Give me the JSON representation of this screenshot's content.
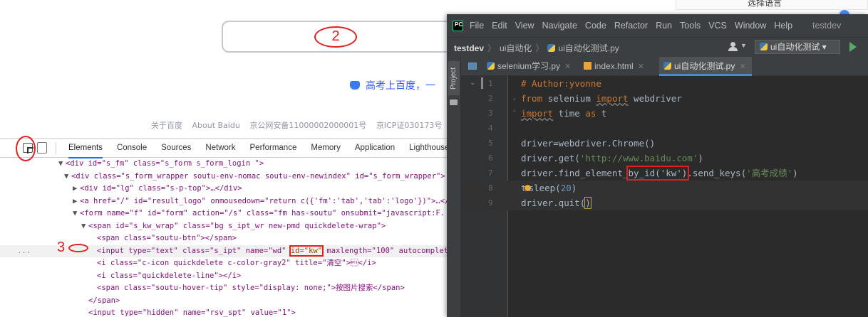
{
  "baidu": {
    "language_box": "选择语言",
    "annotation_2": "2",
    "hot_news": "高考上百度，一",
    "footer": [
      "关于百度",
      "About Baidu",
      "京公网安备11000002000001号",
      "京ICP证030173号",
      "©"
    ]
  },
  "devtools": {
    "annotation_1": "",
    "tabs": [
      "Elements",
      "Console",
      "Sources",
      "Network",
      "Performance",
      "Memory",
      "Application",
      "Lighthouse"
    ],
    "active_tab": "Elements",
    "annotation_3": "3",
    "gutter_dots": "...",
    "dom": {
      "l1": "<div id=\"s_fm\" class=\"s_form s_form_login \">",
      "l2": "<div class=\"s_form_wrapper soutu-env-nomac soutu-env-newindex\" id=\"s_form_wrapper\">",
      "l3": "<div id=\"lg\" class=\"s-p-top\">…</div>",
      "l4": "<a href=\"/\" id=\"result_logo\" onmousedown=\"return c({'fm':'tab','tab':'logo'})\">…</",
      "l5": "<form name=\"f\" id=\"form\" action=\"/s\" class=\"fm  has-soutu\" onsubmit=\"javascript:F.",
      "l6": "<span id=\"s_kw_wrap\" class=\"bg s_ipt_wr new-pmd quickdelete-wrap\">",
      "l7": "<span class=\"soutu-btn\"></span>",
      "l8a": "<input type=\"text\" class=\"s_ipt\" name=\"wd\" ",
      "l8b": "id=\"kw\"",
      "l8c": " maxlength=\"100\" autocomplet",
      "l9": "<i class=\"c-icon quickdelete c-color-gray2\" title=\"清空\">\u0011</i>",
      "l10": "<i class=\"quickdelete-line\"></i>",
      "l11": "<span class=\"soutu-hover-tip\" style=\"display: none;\">按图片搜索</span>",
      "l12": "</span>",
      "l13": "<input type=\"hidden\" name=\"rsv_spt\" value=\"1\">"
    }
  },
  "pycharm": {
    "menu": [
      "File",
      "Edit",
      "View",
      "Navigate",
      "Code",
      "Refactor",
      "Run",
      "Tools",
      "VCS",
      "Window",
      "Help"
    ],
    "menu_mnemonics": [
      "F",
      "E",
      "V",
      "N",
      "C",
      "R",
      "u",
      "T",
      "S",
      "W",
      "H"
    ],
    "project_title": "testdev",
    "breadcrumb": [
      "testdev",
      "ui自动化",
      "ui自动化测试.py"
    ],
    "run_config": "ui自动化测试 ▾",
    "side_label": "Project",
    "tabs": [
      "selenium学习.py",
      "index.html",
      "ui自动化测试.py"
    ],
    "active_tab": "ui自动化测试.py",
    "code": {
      "l1": "# Author:yvonne",
      "l2_kw1": "from",
      "l2_mod": " selenium ",
      "l2_kw2": "import",
      "l2_rest": " webdriver",
      "l3_kw": "import",
      "l3_mod": " time ",
      "l3_kw2": "as",
      "l3_rest": " t",
      "l5": "driver=webdriver.Chrome()",
      "l6_a": "driver.get(",
      "l6_str": "'http://www.baidu.com'",
      "l6_b": ")",
      "l7_a": "driver.find_element_",
      "l7_box": "by_id('kw')",
      "l7_b": ".send_keys(",
      "l7_str": "'高考成绩'",
      "l7_c": ")",
      "l8_a": "t",
      "l8_b": "sleep(",
      "l8_num": "20",
      "l8_c": ")",
      "l9_a": "driver.quit(",
      "l9_b": ")"
    },
    "line_numbers": [
      "1",
      "2",
      "3",
      "4",
      "5",
      "6",
      "7",
      "8",
      "9"
    ]
  }
}
